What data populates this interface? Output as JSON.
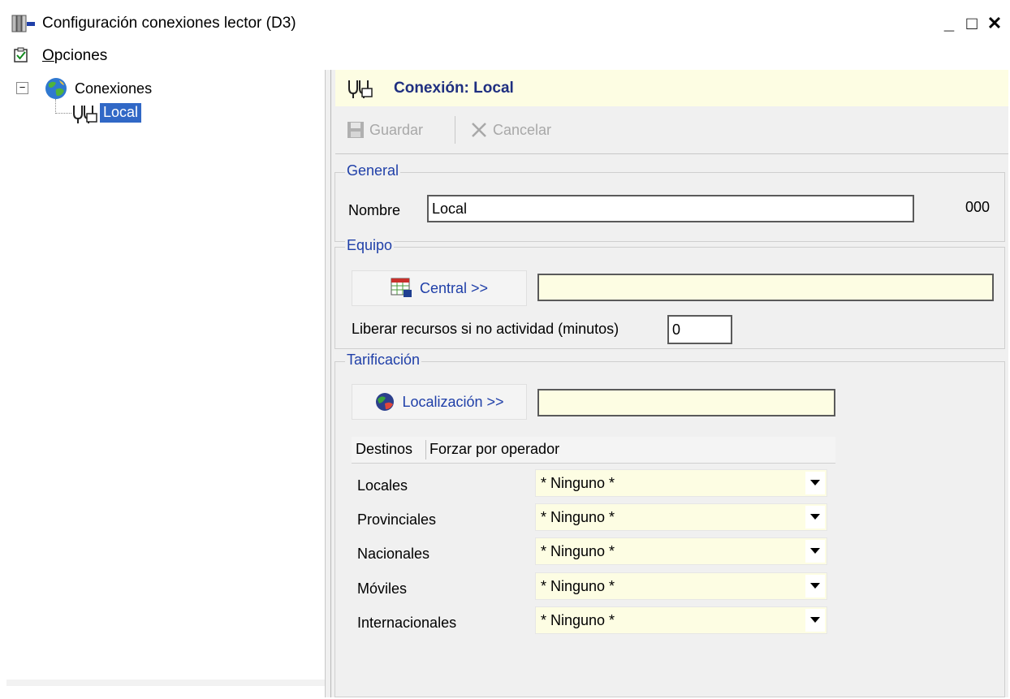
{
  "window": {
    "title": "Configuración conexiones lector (D3)",
    "minimize": "_",
    "maximize": "□",
    "close": "✕"
  },
  "menu": {
    "opciones_first": "O",
    "opciones_rest": "pciones"
  },
  "tree": {
    "root": "Conexiones",
    "child": "Local",
    "expander": "−"
  },
  "panel": {
    "title": "Conexión: Local"
  },
  "toolbar": {
    "save": "Guardar",
    "cancel": "Cancelar"
  },
  "general": {
    "legend": "General",
    "name_label": "Nombre",
    "name_value": "Local",
    "code": "000"
  },
  "equipo": {
    "legend": "Equipo",
    "central_button": "Central >>",
    "central_value": "",
    "release_label": "Liberar recursos si no actividad (minutos)",
    "release_value": "0"
  },
  "tarificacion": {
    "legend": "Tarificación",
    "localizacion_button": "Localización >>",
    "localizacion_value": "",
    "tabs": [
      "Destinos",
      "Forzar por operador"
    ],
    "rows": [
      {
        "label": "Locales",
        "value": "* Ninguno *"
      },
      {
        "label": "Provinciales",
        "value": "* Ninguno *"
      },
      {
        "label": "Nacionales",
        "value": "* Ninguno *"
      },
      {
        "label": "Móviles",
        "value": "* Ninguno *"
      },
      {
        "label": "Internacionales",
        "value": "* Ninguno *"
      }
    ]
  },
  "colors": {
    "label_blue": "#1f3fa8",
    "title_blue": "#1f2f80",
    "selection": "#3168c6",
    "yellow_field": "#fdfde3"
  }
}
